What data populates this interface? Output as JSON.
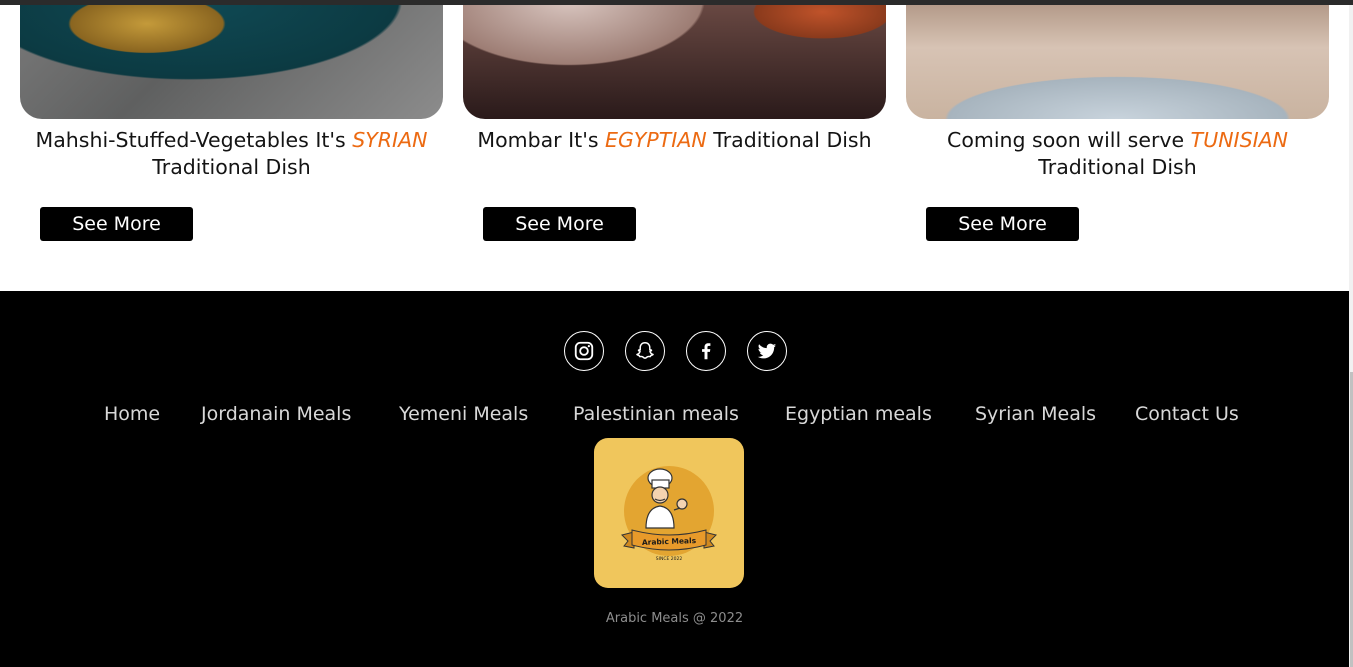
{
  "cards": [
    {
      "title_part1": "Mahshi-Stuffed-Vegetables It's ",
      "highlight": "SYRIAN",
      "title_part2": " Traditional Dish",
      "button": "See More"
    },
    {
      "title_part1": "Mombar It's ",
      "highlight": "EGYPTIAN",
      "title_part2": " Traditional Dish",
      "button": "See More"
    },
    {
      "title_part1": "Coming soon will serve ",
      "highlight": "TUNISIAN",
      "title_part2": " Traditional Dish",
      "button": "See More"
    }
  ],
  "footer": {
    "social": [
      "instagram-icon",
      "snapchat-icon",
      "facebook-icon",
      "twitter-icon"
    ],
    "nav": [
      "Home",
      "Jordanain Meals",
      "Yemeni Meals",
      "Palestinian meals",
      "Egyptian meals",
      "Syrian Meals",
      "Contact Us"
    ],
    "logo": {
      "title": "Arabic Meals",
      "since": "SINCE 2022"
    },
    "copyright": "Arabic Meals @ 2022"
  },
  "colors": {
    "accent": "#ec6a12",
    "footer_bg": "#000000",
    "logo_bg": "#f0c65c"
  }
}
